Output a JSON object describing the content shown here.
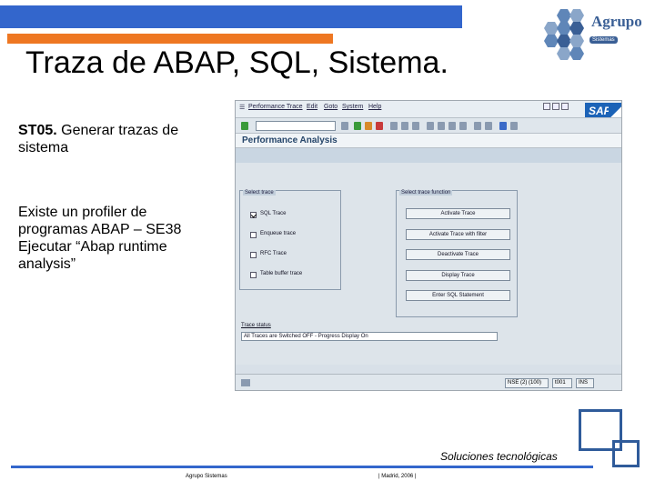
{
  "slide": {
    "title": "Traza de ABAP, SQL, Sistema.",
    "st05_code": "ST05.",
    "st05_text": " Generar trazas de sistema",
    "profiler_text": "Existe un profiler de programas ABAP – SE38 Ejecutar “Abap runtime analysis”",
    "tagline": "Soluciones tecnológicas",
    "footer_left": "Agrupo Sistemas",
    "footer_right": "| Madrid, 2006 |"
  },
  "logo": {
    "name": "Agrupo",
    "sub": "Sistemas",
    "color": "#3a5f95"
  },
  "sap": {
    "menu": [
      "Performance Trace",
      "Edit",
      "Goto",
      "System",
      "Help"
    ],
    "screen_title": "Performance Analysis",
    "brand": "SAP",
    "select_trace": {
      "label": "Select trace",
      "options": [
        {
          "label": "SQL Trace",
          "checked": true
        },
        {
          "label": "Enqueue trace",
          "checked": false
        },
        {
          "label": "RFC Trace",
          "checked": false
        },
        {
          "label": "Table buffer trace",
          "checked": false
        }
      ]
    },
    "trace_functions": {
      "label": "Select trace function",
      "buttons": [
        "Activate Trace",
        "Activate Trace with filter",
        "Deactivate Trace",
        "Display Trace",
        "Enter SQL Statement"
      ]
    },
    "trace_status_label": "Trace status",
    "trace_status_value": "All Traces are Switched OFF - Progress Display On",
    "status": {
      "system": "NSE (2) (100)",
      "server": "t001",
      "mode": "INS"
    }
  },
  "colors": {
    "header_bar": "#3366cc",
    "accent_bar": "#ee7722"
  }
}
